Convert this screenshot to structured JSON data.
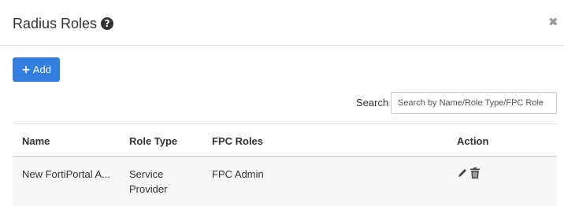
{
  "header": {
    "title": "Radius Roles",
    "help_icon": "question-circle-icon",
    "close_icon": "close-icon",
    "close_glyph": "✖"
  },
  "toolbar": {
    "add_label": "Add",
    "add_icon": "plus-icon"
  },
  "search": {
    "label": "Search",
    "placeholder": "Search by Name/Role Type/FPC Role",
    "value": ""
  },
  "table": {
    "columns": [
      "Name",
      "Role Type",
      "FPC Roles",
      "Action"
    ],
    "rows": [
      {
        "name": "New FortiPortal A...",
        "role_type": "Service Provider",
        "fpc_roles": "FPC Admin",
        "actions": [
          "edit-icon",
          "delete-icon"
        ]
      }
    ]
  },
  "colors": {
    "accent": "#337ee0",
    "row_background": "#f7f7f7",
    "border": "#e5e5e5"
  }
}
